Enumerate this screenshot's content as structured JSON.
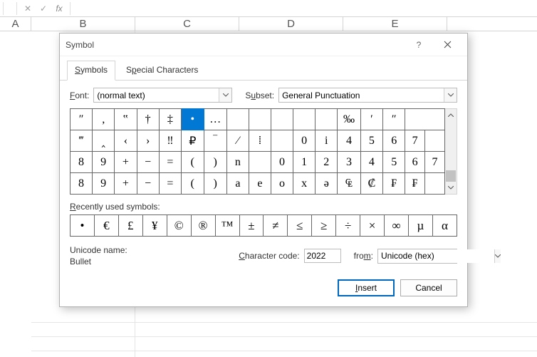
{
  "formula_bar": {
    "cancel_glyph": "✕",
    "confirm_glyph": "✓",
    "fx_glyph": "fx",
    "value": ""
  },
  "columns": [
    "A",
    "B",
    "C",
    "D",
    "E"
  ],
  "dialog": {
    "title": "Symbol",
    "tabs": {
      "symbols": "Symbols",
      "special": "Special Characters"
    },
    "font_label": "Font:",
    "font_value": "(normal text)",
    "subset_label": "Subset:",
    "subset_value": "General Punctuation",
    "char_rows": [
      [
        "″",
        "‚",
        "‟",
        "†",
        "‡",
        "•",
        "…",
        "",
        "",
        "",
        "",
        "",
        "‰",
        "′",
        "″"
      ],
      [
        "‴",
        "‸",
        "‹",
        "›",
        "‼",
        "₽",
        "‾",
        "⁄",
        "⁞",
        "",
        "0",
        "i",
        "4",
        "5",
        "6",
        "7"
      ],
      [
        "8",
        "9",
        "+",
        "−",
        "=",
        "(",
        ")",
        "n",
        "",
        "0",
        "1",
        "2",
        "3",
        "4",
        "5",
        "6",
        "7"
      ],
      [
        "8",
        "9",
        "+",
        "−",
        "=",
        "(",
        ")",
        "a",
        "e",
        "o",
        "x",
        "ə",
        "₠",
        "₡",
        "₣",
        "₣"
      ]
    ],
    "selected": {
      "row": 0,
      "col": 5
    },
    "recent_label": "Recently used symbols:",
    "recent": [
      "•",
      "€",
      "£",
      "¥",
      "©",
      "®",
      "™",
      "±",
      "≠",
      "≤",
      "≥",
      "÷",
      "×",
      "∞",
      "µ",
      "α"
    ],
    "unicode_name_label": "Unicode name:",
    "unicode_name": "Bullet",
    "char_code_label": "Character code:",
    "char_code": "2022",
    "from_label": "from:",
    "from_value": "Unicode (hex)",
    "insert": "Insert",
    "cancel": "Cancel"
  }
}
